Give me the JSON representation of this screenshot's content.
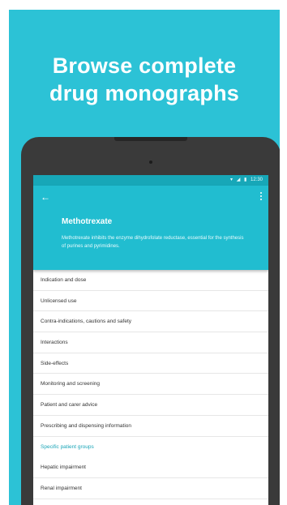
{
  "promo": {
    "headline_line1": "Browse complete",
    "headline_line2": "drug monographs",
    "background_color": "#2cc2d6"
  },
  "device": {
    "status_bar": {
      "wifi_icon": "wifi-icon",
      "signal_icon": "signal-icon",
      "battery_icon": "battery-icon",
      "time": "12:30"
    },
    "app_bar": {
      "back_icon": "arrow-back-icon",
      "more_icon": "more-vert-icon",
      "title": "Methotrexate",
      "description": "Methotrexate inhibits the enzyme dihydrofolate reductase, essential for the synthesis of purines and pyrimidines.",
      "accent_color": "#21bdd0"
    },
    "sections": [
      "Indication and dose",
      "Unlicensed use",
      "Contra-indications, cautions and safety",
      "Interactions",
      "Side-effects",
      "Monitoring and screening",
      "Patient and carer advice",
      "Prescribing and dispensing information"
    ],
    "group_header": "Specific patient groups",
    "group_sections": [
      "Hepatic impairment",
      "Renal impairment"
    ]
  }
}
